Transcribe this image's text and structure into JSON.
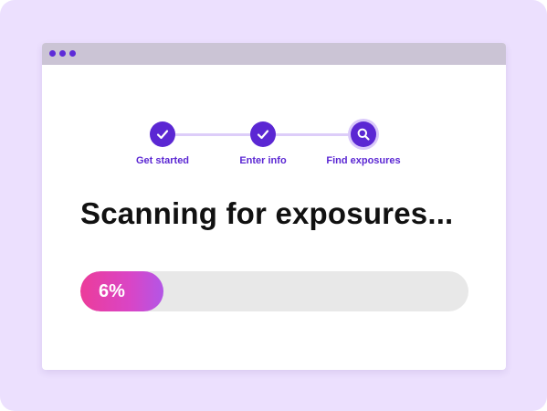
{
  "window": {
    "titlebar_dots": [
      "dot",
      "dot",
      "dot"
    ]
  },
  "stepper": {
    "steps": [
      {
        "label": "Get started",
        "state": "complete",
        "icon": "check-icon"
      },
      {
        "label": "Enter info",
        "state": "complete",
        "icon": "check-icon"
      },
      {
        "label": "Find exposures",
        "state": "active",
        "icon": "search-icon"
      }
    ]
  },
  "heading": "Scanning for exposures...",
  "progress": {
    "value": 0.06,
    "label": "6%"
  },
  "colors": {
    "accent": "#5b27d3",
    "background": "#ece0fe",
    "progress_start": "#ec3c9a",
    "progress_end": "#b356e6",
    "track": "#e8e8e8"
  }
}
